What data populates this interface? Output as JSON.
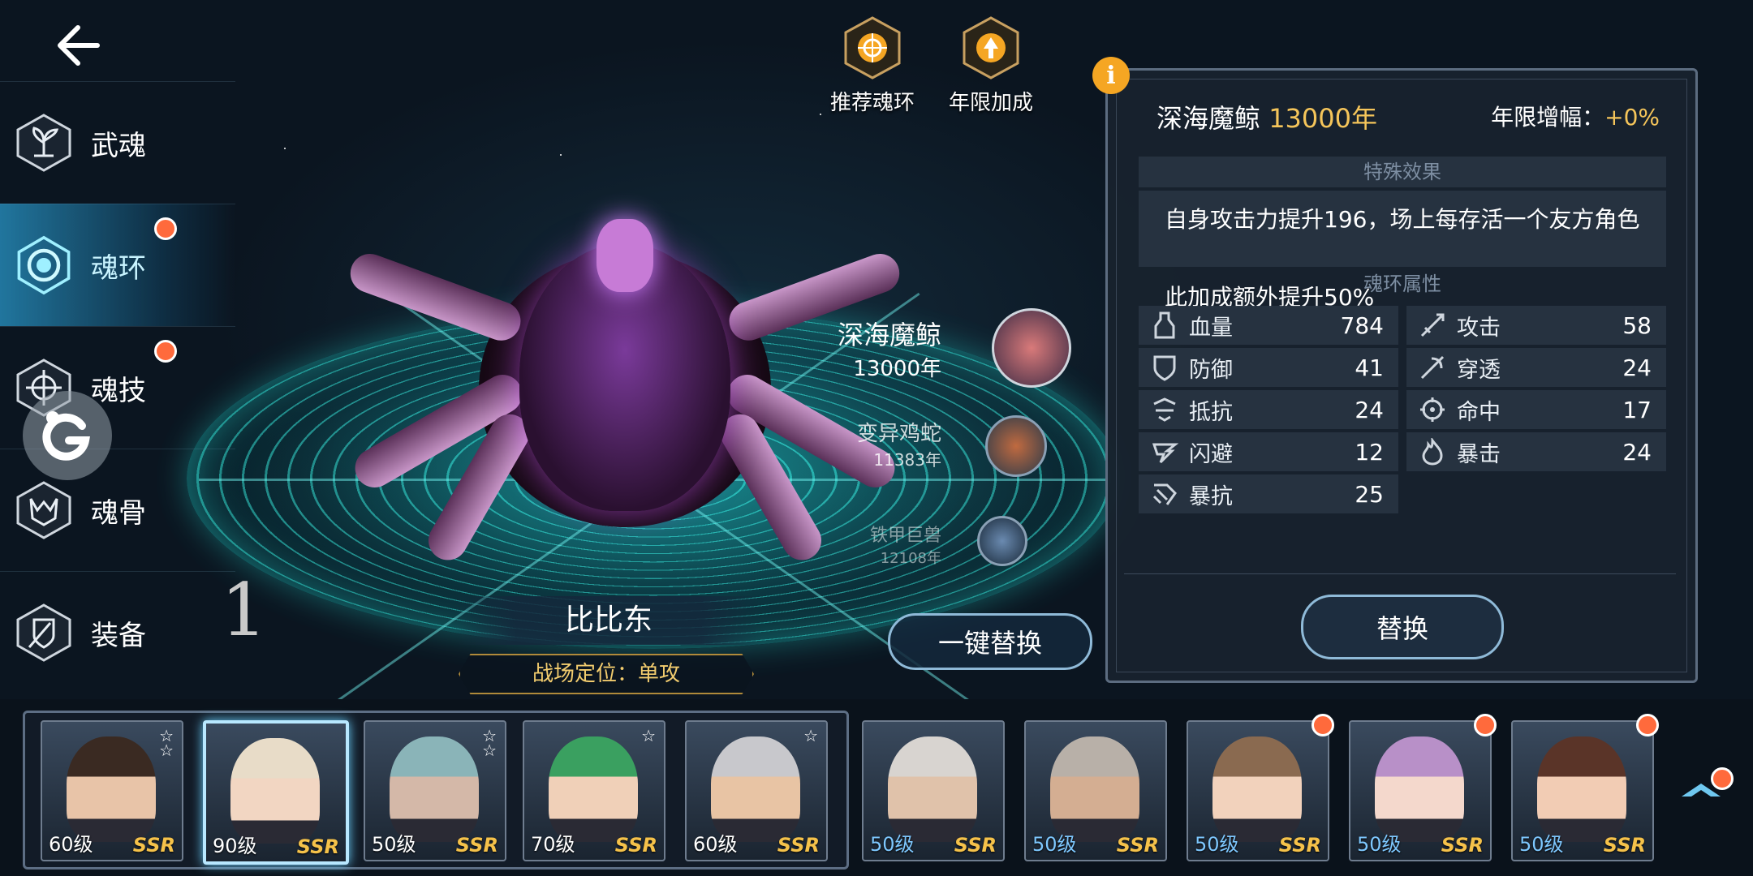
{
  "nav": {
    "items": [
      {
        "label": "武魂",
        "icon": "sprout-icon",
        "active": false,
        "dot": false
      },
      {
        "label": "魂环",
        "icon": "soul-ring-icon",
        "active": true,
        "dot": true
      },
      {
        "label": "魂技",
        "icon": "skill-icon",
        "active": false,
        "dot": true
      },
      {
        "label": "魂骨",
        "icon": "soul-bone-icon",
        "active": false,
        "dot": false
      },
      {
        "label": "装备",
        "icon": "equipment-icon",
        "active": false,
        "dot": false
      }
    ]
  },
  "scene_numeral": "1",
  "top_buttons": {
    "recommend": "推荐魂环",
    "year_bonus": "年限加成"
  },
  "character": {
    "name": "比比东",
    "role": "战场定位：单攻"
  },
  "rings": [
    {
      "name": "深海魔鲸",
      "year": "13000年"
    },
    {
      "name": "变异鸡蛇",
      "year": "11383年"
    },
    {
      "name": "铁甲巨兽",
      "year": "12108年"
    }
  ],
  "one_key_replace": "一键替换",
  "panel": {
    "ring_name": "深海魔鲸",
    "ring_year": "13000年",
    "growth_label": "年限增幅：",
    "growth_value": "+0%",
    "special_effect_header": "特殊效果",
    "special_effect_line1": "自身攻击力提升196，场上每存活一个友方角色",
    "special_effect_line2": "此加成额外提升50%",
    "attributes_header": "魂环属性",
    "stats": [
      {
        "name": "血量",
        "value": "784",
        "icon": "hp-bottle-icon"
      },
      {
        "name": "攻击",
        "value": "58",
        "icon": "attack-sword-icon"
      },
      {
        "name": "防御",
        "value": "41",
        "icon": "defense-shield-icon"
      },
      {
        "name": "穿透",
        "value": "24",
        "icon": "penetration-icon"
      },
      {
        "name": "抵抗",
        "value": "24",
        "icon": "resist-icon"
      },
      {
        "name": "命中",
        "value": "17",
        "icon": "hit-target-icon"
      },
      {
        "name": "闪避",
        "value": "12",
        "icon": "dodge-icon"
      },
      {
        "name": "暴击",
        "value": "24",
        "icon": "crit-flame-icon"
      },
      {
        "name": "暴抗",
        "value": "25",
        "icon": "crit-resist-icon"
      }
    ],
    "replace_label": "替换"
  },
  "roster": [
    {
      "level": "60级",
      "rarity": "SSR",
      "stars": "☆☆",
      "team": true,
      "selected": false,
      "dot": false,
      "hair": "#3a2a22",
      "skin": "#e8c4a8"
    },
    {
      "level": "90级",
      "rarity": "SSR",
      "stars": "",
      "team": true,
      "selected": true,
      "dot": false,
      "hair": "#e8dcc8",
      "skin": "#f2d6c2"
    },
    {
      "level": "50级",
      "rarity": "SSR",
      "stars": "☆☆",
      "team": true,
      "selected": false,
      "dot": false,
      "hair": "#8ab4b8",
      "skin": "#d4b8a8"
    },
    {
      "level": "70级",
      "rarity": "SSR",
      "stars": "☆",
      "team": true,
      "selected": false,
      "dot": false,
      "hair": "#3aa060",
      "skin": "#f0d0b8"
    },
    {
      "level": "60级",
      "rarity": "SSR",
      "stars": "☆",
      "team": true,
      "selected": false,
      "dot": false,
      "hair": "#c8c8cc",
      "skin": "#e8c4a4"
    },
    {
      "level": "50级",
      "rarity": "SSR",
      "stars": "",
      "team": false,
      "selected": false,
      "dot": false,
      "hair": "#d8d4d0",
      "skin": "#e0c2aa"
    },
    {
      "level": "50级",
      "rarity": "SSR",
      "stars": "",
      "team": false,
      "selected": false,
      "dot": false,
      "hair": "#b8b0a8",
      "skin": "#d4ae92"
    },
    {
      "level": "50级",
      "rarity": "SSR",
      "stars": "",
      "team": false,
      "selected": false,
      "dot": true,
      "hair": "#8a6a50",
      "skin": "#f2d2bc"
    },
    {
      "level": "50级",
      "rarity": "SSR",
      "stars": "",
      "team": false,
      "selected": false,
      "dot": true,
      "hair": "#b890c8",
      "skin": "#f4d8cc"
    },
    {
      "level": "50级",
      "rarity": "SSR",
      "stars": "",
      "team": false,
      "selected": false,
      "dot": true,
      "hair": "#5a3428",
      "skin": "#f2ccb4"
    }
  ],
  "colors": {
    "accent_gold": "#f5c55a",
    "active_blue": "#2896c8",
    "notify_red": "#ff6a3c",
    "ssr_gold": "#f5c24a"
  }
}
